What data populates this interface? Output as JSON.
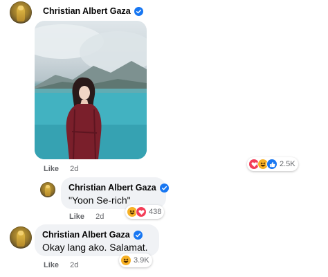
{
  "comment1": {
    "author": "Christian Albert Gaza",
    "like_label": "Like",
    "time": "2d",
    "reactions": {
      "count": "2.5K",
      "icons": [
        "love-icon",
        "haha-icon",
        "like-icon"
      ]
    }
  },
  "reply": {
    "author": "Christian Albert Gaza",
    "text": "\"Yoon Se-rich\"",
    "like_label": "Like",
    "time": "2d",
    "reactions": {
      "count": "438",
      "icons": [
        "haha-icon",
        "love-icon"
      ]
    }
  },
  "comment2": {
    "author": "Christian Albert Gaza",
    "text": "Okay lang ako. Salamat.",
    "like_label": "Like",
    "time": "2d",
    "reactions": {
      "count": "3.9K",
      "icons": [
        "haha-icon"
      ]
    }
  },
  "colors": {
    "verified": "#1877f2",
    "meta_text": "#65676b",
    "bubble_bg": "#f0f2f5"
  }
}
